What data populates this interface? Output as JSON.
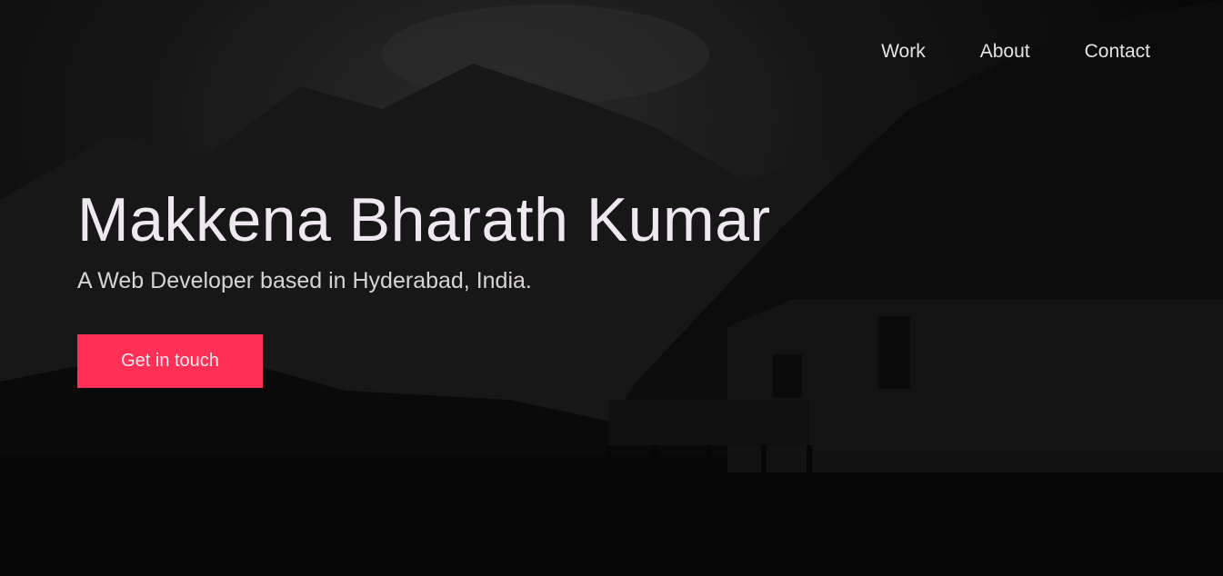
{
  "nav": {
    "items": [
      {
        "label": "Work"
      },
      {
        "label": "About"
      },
      {
        "label": "Contact"
      }
    ]
  },
  "hero": {
    "title": "Makkena Bharath Kumar",
    "subtitle": "A Web Developer based in Hyderabad, India.",
    "cta_label": "Get in touch"
  },
  "colors": {
    "accent": "#ff2f55",
    "background": "#060606",
    "title_text": "#efe8f1",
    "nav_text": "#e4e4e4"
  }
}
